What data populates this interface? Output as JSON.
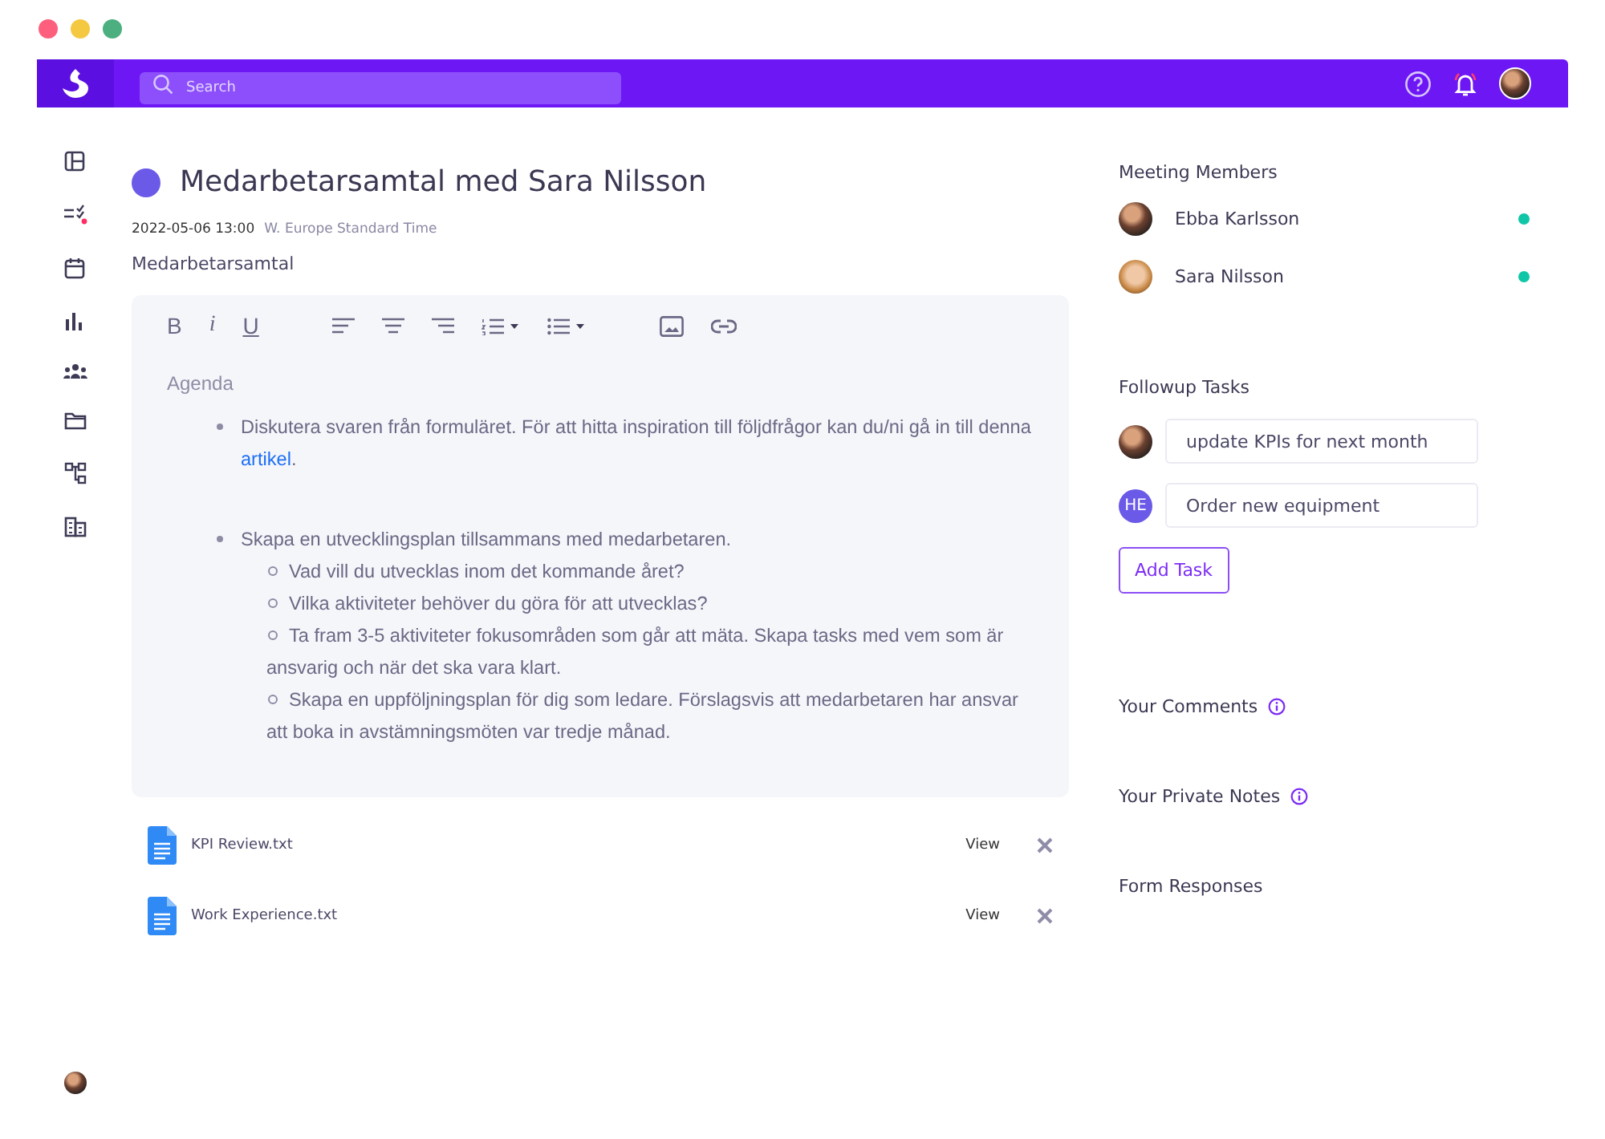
{
  "header": {
    "search": {
      "placeholder": "Search"
    }
  },
  "meeting": {
    "title": "Medarbetarsamtal med Sara Nilsson",
    "datetime": "2022-05-06 13:00",
    "timezone": "W. Europe Standard Time",
    "type": "Medarbetarsamtal"
  },
  "editor": {
    "format_buttons": [
      "B",
      "i",
      "U"
    ],
    "heading": "Agenda",
    "items": [
      {
        "text": "Diskutera svaren från formuläret. För att hitta inspiration till följdfrågor kan du/ni gå in till denna ",
        "link": "artikel",
        "after": "."
      },
      {
        "text": "Skapa en utvecklingsplan tillsammans med medarbetaren.",
        "children": [
          {
            "text": "Vad vill du utvecklas inom det kommande året?"
          },
          {
            "text": "Vilka aktiviteter behöver du göra för att utvecklas?"
          },
          {
            "text": "Ta fram 3-5 aktiviteter fokusområden som går att mäta. Skapa tasks med vem som är ansvarig och när det ska vara klart."
          },
          {
            "text": "Skapa en uppföljningsplan för dig som ledare. Förslagsvis att medarbetaren har ansvar att boka in avstämningsmöten var tredje månad."
          }
        ]
      }
    ]
  },
  "attachments": [
    {
      "name": "KPI Review.txt",
      "action": "View"
    },
    {
      "name": "Work Experience.txt",
      "action": "View"
    }
  ],
  "members": {
    "title": "Meeting Members",
    "items": [
      {
        "name": "Ebba Karlsson",
        "online": true
      },
      {
        "name": "Sara Nilsson",
        "online": true
      }
    ]
  },
  "followup": {
    "title": "Followup Tasks",
    "tasks": [
      {
        "kind": "photo",
        "value": "update KPIs for next month"
      },
      {
        "kind": "initials",
        "initials": "HE",
        "value": "Order new equipment"
      }
    ],
    "add_button": "Add Task"
  },
  "sections": [
    {
      "title": "Your Comments",
      "info": true
    },
    {
      "title": "Your Private Notes",
      "info": true
    },
    {
      "title": "Form Responses",
      "info": false
    }
  ]
}
